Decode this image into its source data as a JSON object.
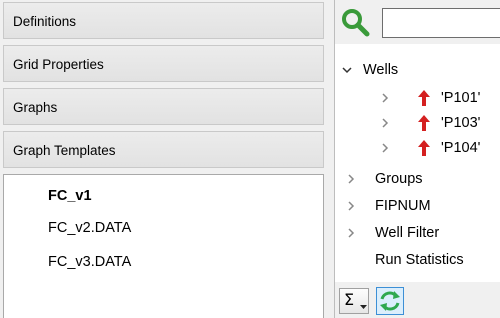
{
  "left_panel": {
    "headers": [
      {
        "label": "Definitions"
      },
      {
        "label": "Grid Properties"
      },
      {
        "label": "Graphs"
      },
      {
        "label": "Graph Templates"
      }
    ],
    "templates": [
      {
        "label": "FC_v1",
        "selected": true
      },
      {
        "label": "FC_v2.DATA"
      },
      {
        "label": "FC_v3.DATA"
      }
    ]
  },
  "right_panel": {
    "search": {
      "placeholder": "",
      "value": ""
    },
    "tree": {
      "wells": {
        "label": "Wells",
        "expanded": true,
        "items": [
          {
            "label": "'P101'",
            "icon": "red-up-arrow-icon"
          },
          {
            "label": "'P103'",
            "icon": "red-up-arrow-icon"
          },
          {
            "label": "'P104'",
            "icon": "red-up-arrow-icon"
          }
        ]
      },
      "groups": {
        "label": "Groups"
      },
      "fipnum": {
        "label": "FIPNUM"
      },
      "well_filter": {
        "label": "Well Filter"
      },
      "run_statistics": {
        "label": "Run Statistics"
      }
    },
    "toolbar": {
      "sum_symbol": "Σ"
    }
  },
  "colors": {
    "arrow_red": "#d42020",
    "search_green": "#3a9a3a",
    "refresh_green": "#2fa84f",
    "accent_blue": "#3c8fd6"
  }
}
